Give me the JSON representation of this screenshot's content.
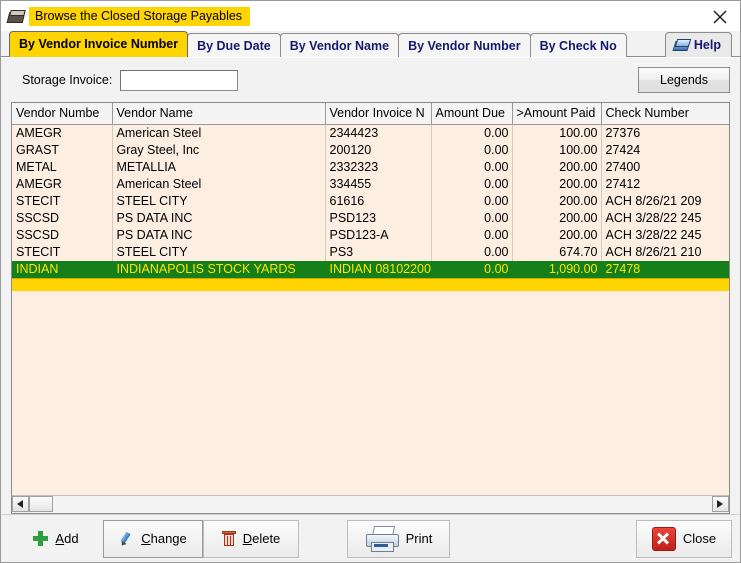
{
  "window": {
    "title": "Browse the Closed Storage Payables",
    "title_icon": "storage-cabinet-icon",
    "close_icon": "close-icon",
    "title_highlight_color": "#ffd400"
  },
  "tabs": {
    "items": [
      {
        "label": "By Vendor Invoice Number",
        "active": true
      },
      {
        "label": "By Due Date",
        "active": false
      },
      {
        "label": "By Vendor Name",
        "active": false
      },
      {
        "label": "By Vendor Number",
        "active": false
      },
      {
        "label": "By Check No",
        "active": false
      }
    ],
    "help_label": "Help",
    "help_icon": "book-icon"
  },
  "search": {
    "label": "Storage Invoice:",
    "value": "",
    "placeholder": ""
  },
  "legends_button": {
    "label": "Legends"
  },
  "grid": {
    "columns": [
      {
        "header": "Vendor Numbe",
        "align": "left"
      },
      {
        "header": "Vendor Name",
        "align": "left"
      },
      {
        "header": "Vendor Invoice N",
        "align": "left"
      },
      {
        "header": "Amount Due",
        "align": "right"
      },
      {
        "header": ">Amount Paid",
        "align": "right"
      },
      {
        "header": "Check Number",
        "align": "left"
      }
    ],
    "rows": [
      {
        "vendor_number": "AMEGR",
        "vendor_name": "American Steel",
        "vendor_invoice": "2344423",
        "amount_due": "0.00",
        "amount_paid": "100.00",
        "check_number": "27376",
        "selected": false
      },
      {
        "vendor_number": "GRAST",
        "vendor_name": "Gray Steel, Inc",
        "vendor_invoice": "200120",
        "amount_due": "0.00",
        "amount_paid": "100.00",
        "check_number": "27424",
        "selected": false
      },
      {
        "vendor_number": "METAL",
        "vendor_name": "METALLIA",
        "vendor_invoice": "2332323",
        "amount_due": "0.00",
        "amount_paid": "200.00",
        "check_number": "27400",
        "selected": false
      },
      {
        "vendor_number": "AMEGR",
        "vendor_name": "American Steel",
        "vendor_invoice": "334455",
        "amount_due": "0.00",
        "amount_paid": "200.00",
        "check_number": "27412",
        "selected": false
      },
      {
        "vendor_number": "STECIT",
        "vendor_name": "STEEL CITY",
        "vendor_invoice": "61616",
        "amount_due": "0.00",
        "amount_paid": "200.00",
        "check_number": "ACH   8/26/21 209",
        "selected": false
      },
      {
        "vendor_number": "SSCSD",
        "vendor_name": "PS DATA INC",
        "vendor_invoice": "PSD123",
        "amount_due": "0.00",
        "amount_paid": "200.00",
        "check_number": "ACH   3/28/22 245",
        "selected": false
      },
      {
        "vendor_number": "SSCSD",
        "vendor_name": "PS DATA INC",
        "vendor_invoice": "PSD123-A",
        "amount_due": "0.00",
        "amount_paid": "200.00",
        "check_number": "ACH   3/28/22 245",
        "selected": false
      },
      {
        "vendor_number": "STECIT",
        "vendor_name": "STEEL CITY",
        "vendor_invoice": "PS3",
        "amount_due": "0.00",
        "amount_paid": "674.70",
        "check_number": "ACH   8/26/21 210",
        "selected": false
      },
      {
        "vendor_number": "INDIAN",
        "vendor_name": "INDIANAPOLIS STOCK YARDS",
        "vendor_invoice": "INDIAN 08102200",
        "amount_due": "0.00",
        "amount_paid": "1,090.00",
        "check_number": "27478",
        "selected": true
      }
    ],
    "selected_row_bg": "#15801b",
    "selected_row_fg": "#ffe400",
    "row_bg": "#fdeee2",
    "marker_strip_color": "#ffd400"
  },
  "scrollbar": {
    "left_arrow_icon": "arrow-left-icon",
    "right_arrow_icon": "arrow-right-icon"
  },
  "toolbar": {
    "add": {
      "label": "Add",
      "accel": "A",
      "icon": "plus-icon"
    },
    "change": {
      "label": "Change",
      "accel": "C",
      "icon": "pencil-icon"
    },
    "delete": {
      "label": "Delete",
      "accel": "D",
      "icon": "trash-icon"
    },
    "print": {
      "label": "Print",
      "icon": "printer-icon"
    },
    "close": {
      "label": "Close",
      "icon": "close-x-icon"
    }
  }
}
